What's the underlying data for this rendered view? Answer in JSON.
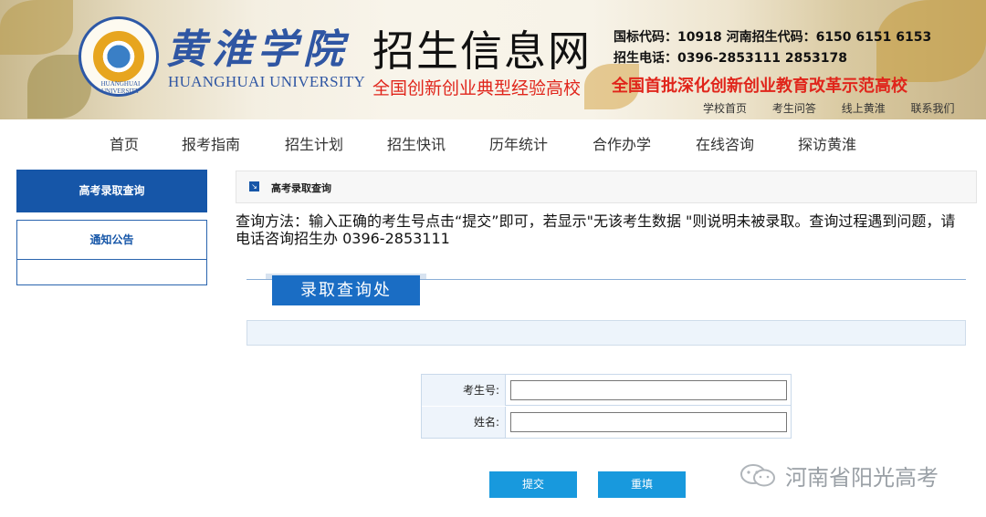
{
  "banner": {
    "logo_caption": "HUANGHUAI UNIVERSITY",
    "school_cn": "黄淮学院",
    "school_en": "HUANGHUAI UNIVERSITY",
    "site_title": "招生信息网",
    "site_subtitle": "全国创新创业典型经验高校",
    "code_line1": "国标代码：10918  河南招生代码：6150 6151 6153",
    "code_line2": "招生电话：0396-2853111    2853178",
    "slogan": "全国首批深化创新创业教育改革示范高校",
    "top_links": [
      "学校首页",
      "考生问答",
      "线上黄淮",
      "联系我们"
    ]
  },
  "nav": {
    "items": [
      "首页",
      "报考指南",
      "招生计划",
      "招生快讯",
      "历年统计",
      "合作办学",
      "在线咨询",
      "探访黄淮"
    ]
  },
  "sidebar": {
    "active_label": "高考录取查询",
    "items": [
      "通知公告"
    ]
  },
  "breadcrumb": {
    "title": "高考录取查询"
  },
  "hint": "查询方法：输入正确的考生号点击“提交”即可，若显示\"无该考生数据 \"则说明未被录取。查询过程遇到问题，请电话咨询招生办 0396-2853111",
  "section": {
    "title": "录取查询处"
  },
  "form": {
    "exam_no_label": "考生号:",
    "exam_no_value": "",
    "name_label": "姓名:",
    "name_value": "",
    "submit_label": "提交",
    "reset_label": "重填"
  },
  "watermark": {
    "text": "河南省阳光高考"
  },
  "colors": {
    "primary": "#1656a8",
    "accent_red": "#e0251b",
    "button": "#1899dd"
  }
}
